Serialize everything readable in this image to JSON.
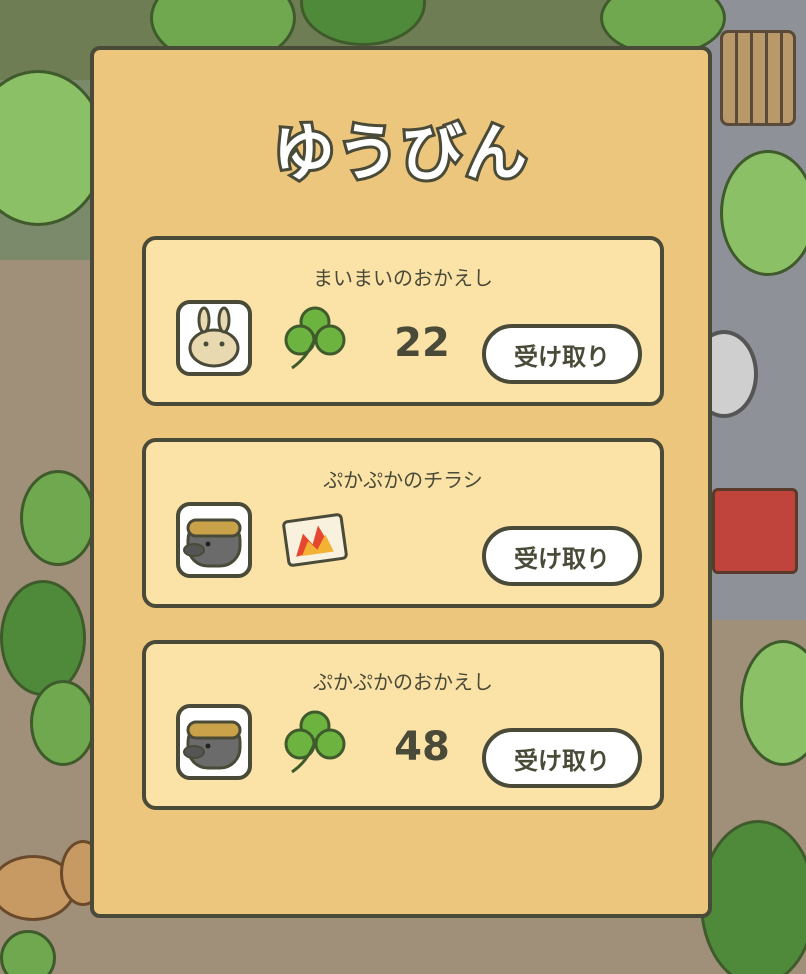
{
  "mail": {
    "title": "ゆうびん",
    "items": [
      {
        "sender": "まいまいのおかえし",
        "avatar": "snail-rabbit-icon",
        "reward_icon": "clover-icon",
        "count": "22",
        "button": "受け取り"
      },
      {
        "sender": "ぷかぷかのチラシ",
        "avatar": "mole-icon",
        "reward_icon": "flyer-icon",
        "count": "",
        "button": "受け取り"
      },
      {
        "sender": "ぷかぷかのおかえし",
        "avatar": "mole-icon",
        "reward_icon": "clover-icon",
        "count": "48",
        "button": "受け取り"
      }
    ]
  },
  "colors": {
    "panel": "#ecc67c",
    "card": "#fbe3a7",
    "outline": "#4a4a38",
    "clover": "#6db33f"
  }
}
